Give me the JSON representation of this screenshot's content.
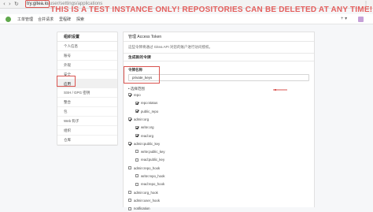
{
  "browser": {
    "url_host": "try.gitea.io",
    "url_path": "/user/settings/applications"
  },
  "warning": "THIS IS A TEST INSTANCE ONLY! REPOSITORIES CAN BE DELETED AT ANY TIME!",
  "nav": {
    "items": [
      "工单管理",
      "合并请求",
      "里程碑",
      "探索"
    ],
    "plus": "+ ▾"
  },
  "sidebar": {
    "title": "组织设置",
    "items": [
      {
        "label": "个人信息"
      },
      {
        "label": "账号"
      },
      {
        "label": "外观"
      },
      {
        "label": "安全"
      },
      {
        "label": "应用",
        "active": true
      },
      {
        "label": "SSH / GPG 密钥"
      },
      {
        "label": "整合"
      },
      {
        "label": "包"
      },
      {
        "label": "Web 钩子"
      },
      {
        "label": "组织"
      },
      {
        "label": "仓库"
      }
    ]
  },
  "main": {
    "header": "管理 Access Token",
    "description": "这些令牌将通过 Gitea API 对您的账户进行访问授权。",
    "generate_header": "生成新的令牌",
    "name_label": "令牌名称",
    "name_value": "private_keys",
    "perm_label": "• 选择范围",
    "scopes": [
      {
        "label": "repo",
        "checked": true,
        "level": 0
      },
      {
        "label": "repo:status",
        "checked": true,
        "level": 1
      },
      {
        "label": "public_repo",
        "checked": true,
        "level": 1
      },
      {
        "label": "admin:org",
        "checked": true,
        "level": 0
      },
      {
        "label": "write:org",
        "checked": true,
        "level": 1
      },
      {
        "label": "read:org",
        "checked": true,
        "level": 1
      },
      {
        "label": "admin:public_key",
        "checked": true,
        "level": 0
      },
      {
        "label": "write:public_key",
        "checked": false,
        "level": 1
      },
      {
        "label": "read:public_key",
        "checked": false,
        "level": 1
      },
      {
        "label": "admin:repo_hook",
        "checked": false,
        "level": 0
      },
      {
        "label": "write:repo_hook",
        "checked": false,
        "level": 1
      },
      {
        "label": "read:repo_hook",
        "checked": false,
        "level": 1
      },
      {
        "label": "admin:org_hook",
        "checked": false,
        "level": 0
      },
      {
        "label": "admin:user_hook",
        "checked": false,
        "level": 0
      },
      {
        "label": "notification",
        "checked": false,
        "level": 0
      }
    ]
  },
  "colors": {
    "annotation_red": "#d9534f",
    "warning_text": "#e4605e",
    "logo_green": "#60a84c"
  }
}
